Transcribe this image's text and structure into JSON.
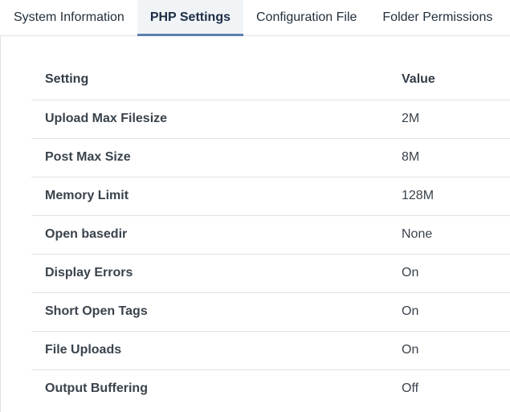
{
  "tabs": [
    {
      "label": "System Information",
      "active": false
    },
    {
      "label": "PHP Settings",
      "active": true
    },
    {
      "label": "Configuration File",
      "active": false
    },
    {
      "label": "Folder Permissions",
      "active": false
    }
  ],
  "table": {
    "headers": {
      "setting": "Setting",
      "value": "Value"
    },
    "rows": [
      {
        "setting": "Upload Max Filesize",
        "value": "2M"
      },
      {
        "setting": "Post Max Size",
        "value": "8M"
      },
      {
        "setting": "Memory Limit",
        "value": "128M"
      },
      {
        "setting": "Open basedir",
        "value": "None"
      },
      {
        "setting": "Display Errors",
        "value": "On"
      },
      {
        "setting": "Short Open Tags",
        "value": "On"
      },
      {
        "setting": "File Uploads",
        "value": "On"
      },
      {
        "setting": "Output Buffering",
        "value": "Off"
      }
    ]
  }
}
